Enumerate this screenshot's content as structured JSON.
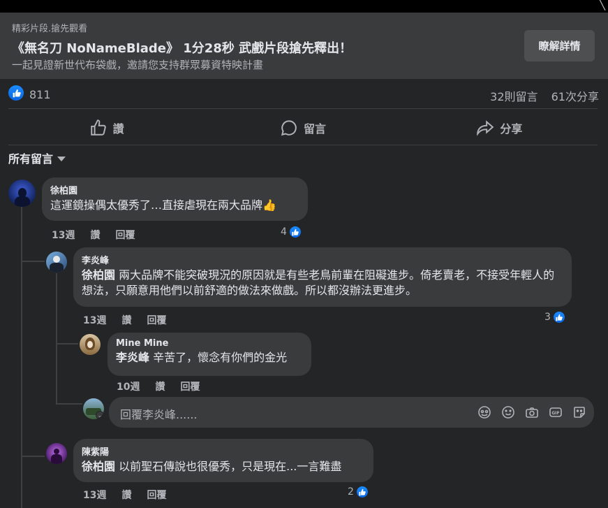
{
  "promo": {
    "small": "精彩片段.搶先觀看",
    "title": "《無名刀 NoNameBlade》 1分28秒 武戲片段搶先釋出！",
    "subtitle": "一起見證新世代布袋戲，邀請您支持群眾募資特映計畫",
    "button": "瞭解詳情"
  },
  "stats": {
    "likes": "811",
    "comments": "32則留言",
    "shares": "61次分享"
  },
  "actions": {
    "like": "讚",
    "comment": "留言",
    "share": "分享"
  },
  "sort_label": "所有留言",
  "comments": [
    {
      "author": "徐柏園",
      "text": "這運鏡操偶太優秀了…直接虐現在兩大品牌👍",
      "time": "13週",
      "like": "讚",
      "reply": "回覆",
      "reactions": "4"
    },
    {
      "author": "李炎峰",
      "mention": "徐柏園",
      "text": " 兩大品牌不能突破現況的原因就是有些老鳥前輩在阻礙進步。倚老賣老，不接受年輕人的想法，只願意用他們以前舒適的做法來做戲。所以都沒辦法更進步。",
      "time": "13週",
      "like": "讚",
      "reply": "回覆",
      "reactions": "3"
    },
    {
      "author": "Mine Mine",
      "mention": "李炎峰",
      "text": " 辛苦了，懷念有你們的金光",
      "time": "10週",
      "like": "讚",
      "reply": "回覆"
    },
    {
      "author": "陳紫陽",
      "mention": "徐柏園",
      "text": " 以前聖石傳說也很優秀，只是現在...一言難盡",
      "time": "13週",
      "like": "讚",
      "reply": "回覆",
      "reactions": "2"
    }
  ],
  "reply_box": {
    "placeholder": "回覆李炎峰......"
  },
  "colors": {
    "background": "#242526",
    "bubble": "#3a3b3c",
    "accent": "#1877f2"
  }
}
